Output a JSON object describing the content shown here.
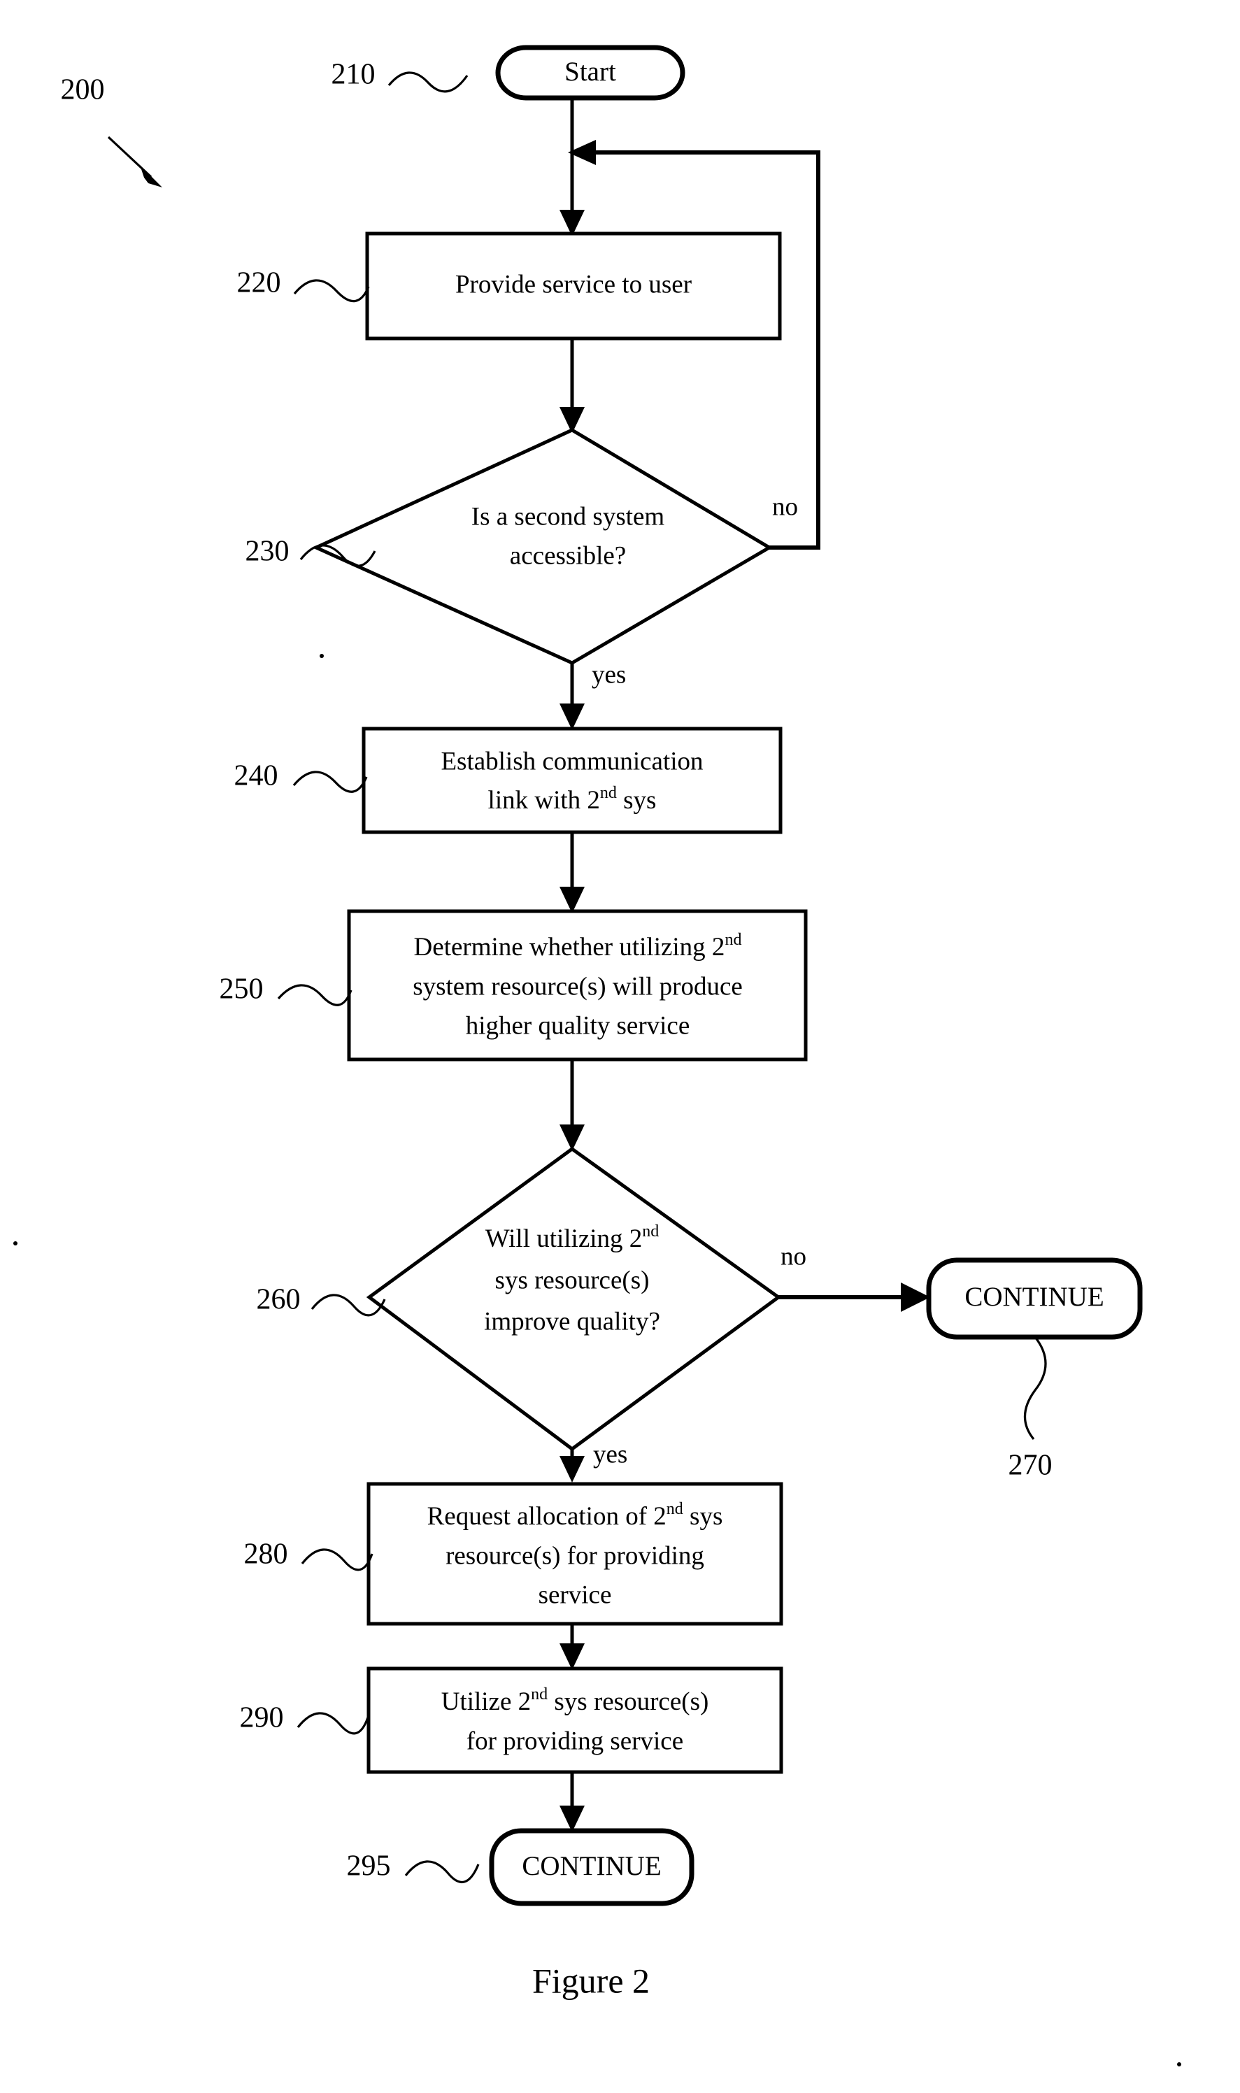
{
  "figure": {
    "caption": "Figure 2",
    "diagram_ref": "200",
    "type": "flowchart"
  },
  "nodes": [
    {
      "ref": "210",
      "kind": "terminator",
      "lines": [
        "Start"
      ]
    },
    {
      "ref": "220",
      "kind": "process",
      "lines": [
        "Provide service to user"
      ]
    },
    {
      "ref": "230",
      "kind": "decision",
      "lines": [
        "Is a second system",
        "accessible?"
      ]
    },
    {
      "ref": "240",
      "kind": "process",
      "lines": [
        "Establish communication",
        "link with 2",
        "sys"
      ],
      "line1": "Establish communication",
      "line2_pre": "link with 2",
      "line2_sup": "nd",
      "line2_post": " sys"
    },
    {
      "ref": "250",
      "kind": "process",
      "line1_pre": "Determine whether utilizing 2",
      "line1_sup": "nd",
      "line2": "system resource(s) will produce",
      "line3": "higher quality service"
    },
    {
      "ref": "260",
      "kind": "decision",
      "line1_pre": "Will utilizing 2",
      "line1_sup": "nd",
      "line2": "sys resource(s)",
      "line3": "improve quality?"
    },
    {
      "ref": "270",
      "kind": "terminator",
      "lines": [
        "CONTINUE"
      ]
    },
    {
      "ref": "280",
      "kind": "process",
      "line1_pre": "Request allocation of 2",
      "line1_sup": "nd",
      "line1_post": " sys",
      "line2": "resource(s) for providing",
      "line3": "service"
    },
    {
      "ref": "290",
      "kind": "process",
      "line1_pre": "Utilize 2",
      "line1_sup": "nd",
      "line1_post": " sys resource(s)",
      "line2": "for providing service"
    },
    {
      "ref": "295",
      "kind": "terminator",
      "lines": [
        "CONTINUE"
      ]
    }
  ],
  "edge_labels": {
    "decision_230_no": "no",
    "decision_230_yes": "yes",
    "decision_260_no": "no",
    "decision_260_yes": "yes"
  },
  "colors": {
    "ink": "#000000",
    "paper": "#ffffff"
  }
}
